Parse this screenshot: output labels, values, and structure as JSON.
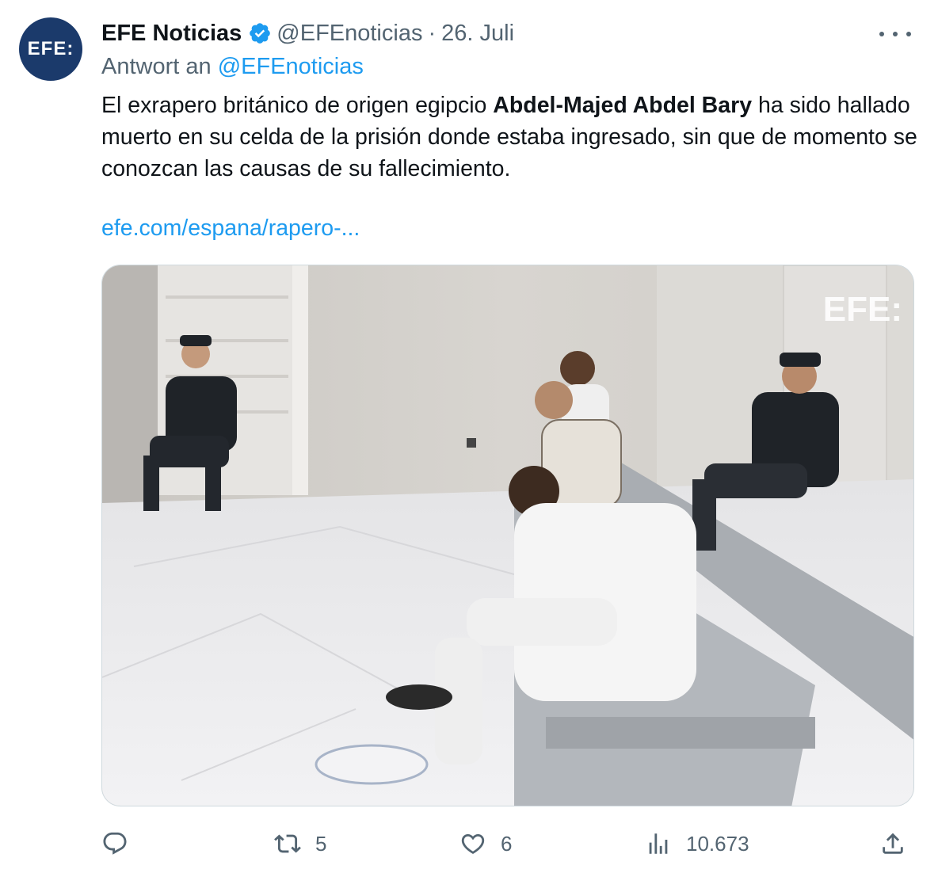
{
  "tweet": {
    "avatar_text": "EFE:",
    "author_name": "EFE Noticias",
    "handle": "@EFEnoticias",
    "separator": "·",
    "date": "26. Juli",
    "reply_prefix": "Antwort an",
    "reply_mention": "@EFEnoticias",
    "text_before": "El exrapero británico de origen egipcio ",
    "text_bold": "Abdel-Majed Abdel Bary",
    "text_after": " ha sido hallado muerto en su celda de la prisión donde estaba ingresado, sin que de momento se conozcan las causas de su fallecimiento.",
    "link": "efe.com/espana/rapero-...",
    "media_watermark": "EFE:"
  },
  "actions": {
    "reply_count": "",
    "retweet_count": "5",
    "like_count": "6",
    "views_count": "10.673"
  },
  "icons": {
    "more": "more-dots-icon",
    "verified": "verified-badge-icon",
    "reply": "reply-icon",
    "retweet": "retweet-icon",
    "like": "heart-icon",
    "views": "views-chart-icon",
    "share": "share-icon"
  },
  "colors": {
    "accent": "#1d9bf0",
    "muted": "#536471",
    "text": "#0f1419",
    "avatar_bg": "#1b3a6b"
  }
}
